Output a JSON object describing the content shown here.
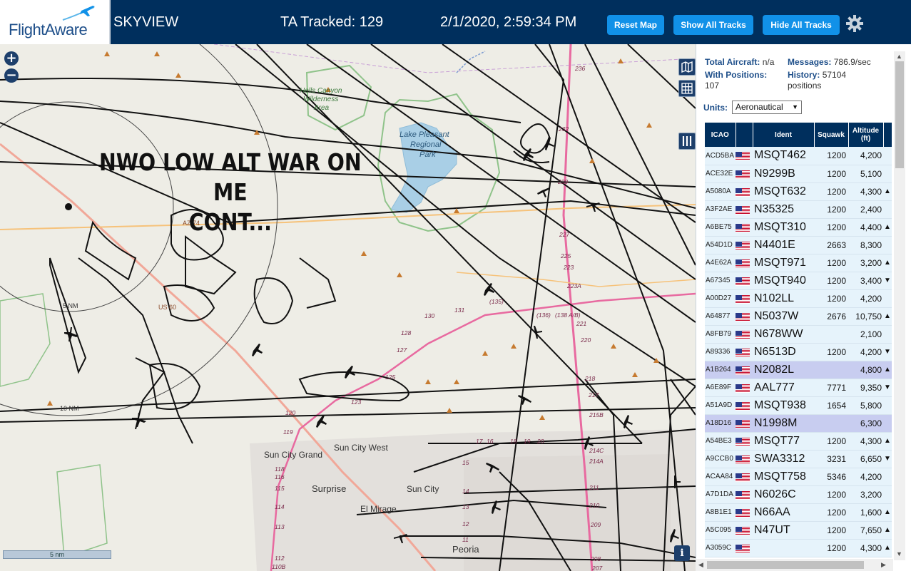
{
  "header": {
    "logo": "FlightAware",
    "app_title": "SKYVIEW",
    "ta_tracked": "TA Tracked: 129",
    "clock": "2/1/2020, 2:59:34 PM",
    "buttons": {
      "reset": "Reset Map",
      "show_all": "Show All Tracks",
      "hide_all": "Hide All Tracks"
    }
  },
  "map": {
    "overlay_line1": "NWO LOW ALT WAR ON ME",
    "overlay_line2": "CONT...",
    "scale_label": "5 nm",
    "zoom_in": "+",
    "zoom_out": "−",
    "info": "i",
    "labels": [
      "Hells Canyon",
      "Wilderness",
      "Area",
      "Lake Pleasant",
      "Regional",
      "Park",
      "Sun City Grand",
      "Sun City West",
      "Surprise",
      "Sun City",
      "El Mirage",
      "Peoria",
      "5 NM",
      "10 NM",
      "AZ 74",
      "US 60",
      "236",
      "232",
      "229",
      "227",
      "225",
      "223",
      "223A",
      "221",
      "220",
      "218",
      "217",
      "215B",
      "214C",
      "214A",
      "211",
      "210",
      "209",
      "208",
      "207",
      "131",
      "130",
      "128",
      "127",
      "125",
      "123",
      "120",
      "119",
      "118",
      "116",
      "115",
      "114",
      "113",
      "112",
      "110B",
      "(135)",
      "(136)",
      "(138 A/B)",
      "17",
      "16",
      "18",
      "19",
      "20",
      "15",
      "14",
      "13",
      "12",
      "11"
    ]
  },
  "stats": {
    "total_aircraft_label": "Total Aircraft:",
    "total_aircraft_value": "n/a",
    "messages_label": "Messages:",
    "messages_value": "786.9/sec",
    "with_positions_label": "With Positions:",
    "with_positions_value": "107",
    "history_label": "History:",
    "history_value": "57104",
    "history_unit": "positions",
    "units_label": "Units:",
    "units_value": "Aeronautical"
  },
  "table": {
    "columns": [
      "ICAO",
      "",
      "Ident",
      "Squawk",
      "Altitude (ft)",
      ""
    ],
    "rows": [
      {
        "icao": "ACD5BA",
        "ident": "MSQT462",
        "squawk": "1200",
        "altitude": "4,200",
        "trend": ""
      },
      {
        "icao": "ACE32E",
        "ident": "N9299B",
        "squawk": "1200",
        "altitude": "5,100",
        "trend": ""
      },
      {
        "icao": "A5080A",
        "ident": "MSQT632",
        "squawk": "1200",
        "altitude": "4,300",
        "trend": "▲"
      },
      {
        "icao": "A3F2AE",
        "ident": "N35325",
        "squawk": "1200",
        "altitude": "2,400",
        "trend": ""
      },
      {
        "icao": "A6BE75",
        "ident": "MSQT310",
        "squawk": "1200",
        "altitude": "4,400",
        "trend": "▲"
      },
      {
        "icao": "A54D1D",
        "ident": "N4401E",
        "squawk": "2663",
        "altitude": "8,300",
        "trend": ""
      },
      {
        "icao": "A4E62A",
        "ident": "MSQT971",
        "squawk": "1200",
        "altitude": "3,200",
        "trend": "▲"
      },
      {
        "icao": "A67345",
        "ident": "MSQT940",
        "squawk": "1200",
        "altitude": "3,400",
        "trend": "▼"
      },
      {
        "icao": "A00D27",
        "ident": "N102LL",
        "squawk": "1200",
        "altitude": "4,200",
        "trend": ""
      },
      {
        "icao": "A64877",
        "ident": "N5037W",
        "squawk": "2676",
        "altitude": "10,750",
        "trend": "▲"
      },
      {
        "icao": "A8FB79",
        "ident": "N678WW",
        "squawk": "",
        "altitude": "2,100",
        "trend": ""
      },
      {
        "icao": "A89336",
        "ident": "N6513D",
        "squawk": "1200",
        "altitude": "4,200",
        "trend": "▼"
      },
      {
        "icao": "A1B264",
        "ident": "N2082L",
        "squawk": "",
        "altitude": "4,800",
        "trend": "▲",
        "selected": true
      },
      {
        "icao": "A6E89F",
        "ident": "AAL777",
        "squawk": "7771",
        "altitude": "9,350",
        "trend": "▼"
      },
      {
        "icao": "A51A9D",
        "ident": "MSQT938",
        "squawk": "1654",
        "altitude": "5,800",
        "trend": ""
      },
      {
        "icao": "A18D16",
        "ident": "N1998M",
        "squawk": "",
        "altitude": "6,300",
        "trend": "",
        "selected": true
      },
      {
        "icao": "A54BE3",
        "ident": "MSQT77",
        "squawk": "1200",
        "altitude": "4,300",
        "trend": "▲"
      },
      {
        "icao": "A9CCB0",
        "ident": "SWA3312",
        "squawk": "3231",
        "altitude": "6,650",
        "trend": "▼"
      },
      {
        "icao": "ACAA84",
        "ident": "MSQT758",
        "squawk": "5346",
        "altitude": "4,200",
        "trend": ""
      },
      {
        "icao": "A7D1DA",
        "ident": "N6026C",
        "squawk": "1200",
        "altitude": "3,200",
        "trend": ""
      },
      {
        "icao": "A8B1E1",
        "ident": "N66AA",
        "squawk": "1200",
        "altitude": "1,600",
        "trend": "▲"
      },
      {
        "icao": "A5C095",
        "ident": "N47UT",
        "squawk": "1200",
        "altitude": "7,650",
        "trend": "▲"
      },
      {
        "icao": "A3059C",
        "ident": "",
        "squawk": "1200",
        "altitude": "4,300",
        "trend": "▲"
      }
    ]
  },
  "icons": [
    "airplane-icon",
    "gear-icon",
    "map-layer-icon",
    "grid-icon",
    "columns-icon",
    "info-icon",
    "flag-icon"
  ]
}
